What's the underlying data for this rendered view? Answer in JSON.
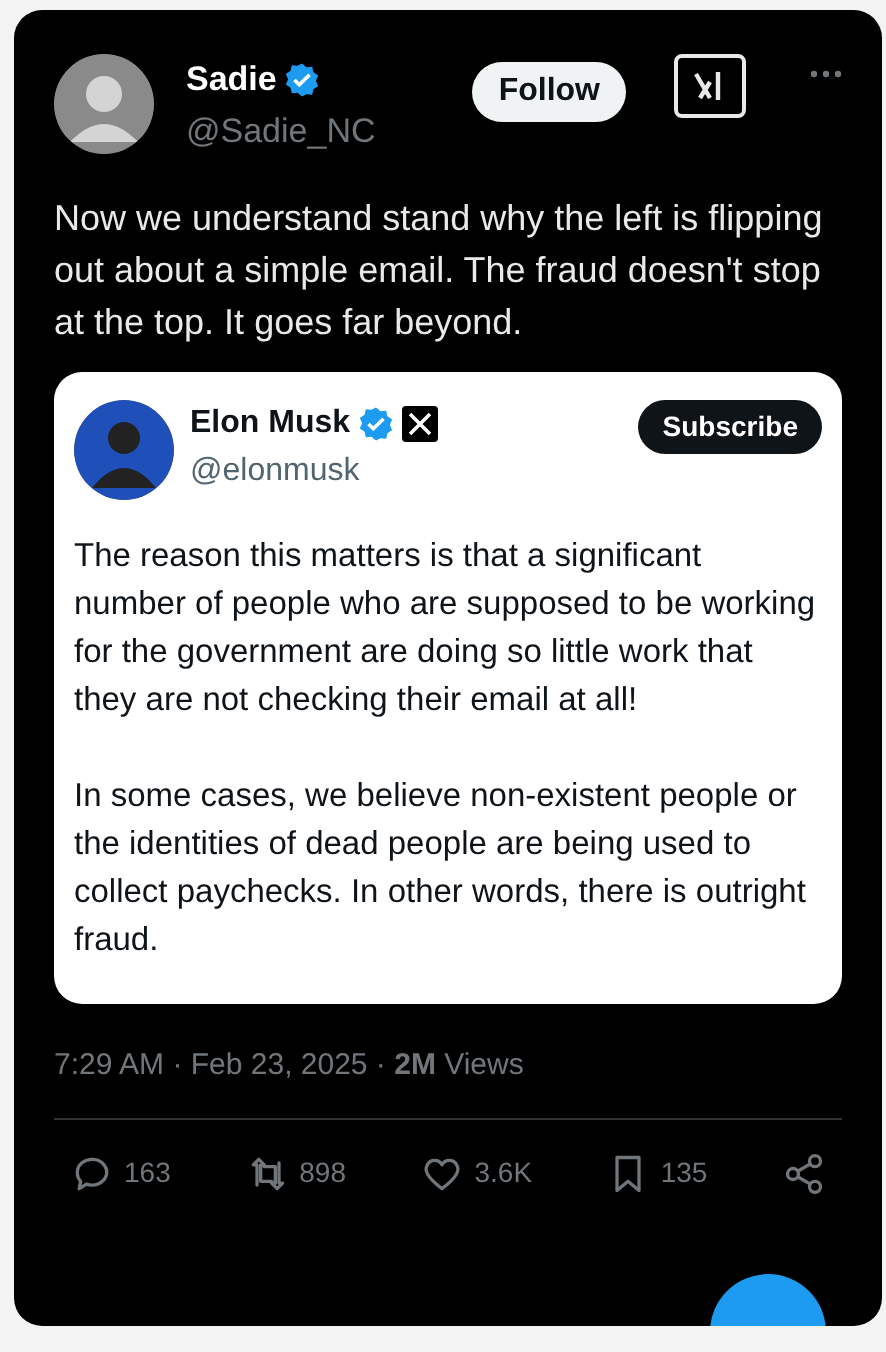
{
  "author": {
    "name": "Sadie",
    "verified": true,
    "handle": "@Sadie_NC"
  },
  "follow_button": "Follow",
  "tweet_text": "Now we understand stand why the left is flipping out about a simple email. The fraud doesn't stop at the top. It goes far beyond.",
  "quoted": {
    "name": "Elon Musk",
    "verified": true,
    "handle": "@elonmusk",
    "subscribe_button": "Subscribe",
    "paragraphs": [
      "The reason this matters is that a significant number of people who are supposed to be working for the government are doing so little work that they are not checking their email at all!",
      "In some cases, we believe non-existent people or the identities of dead people are being used to collect paychecks. In other words, there is outright fraud."
    ]
  },
  "meta": "7:29 AM · Feb 23, 2025 · **2M** Views",
  "actions": [
    {
      "kind": "reply",
      "count": "163"
    },
    {
      "kind": "repost",
      "count": "898"
    },
    {
      "kind": "like",
      "count": "3.6K"
    },
    {
      "kind": "bookmark",
      "count": "135"
    },
    {
      "kind": "share"
    }
  ]
}
